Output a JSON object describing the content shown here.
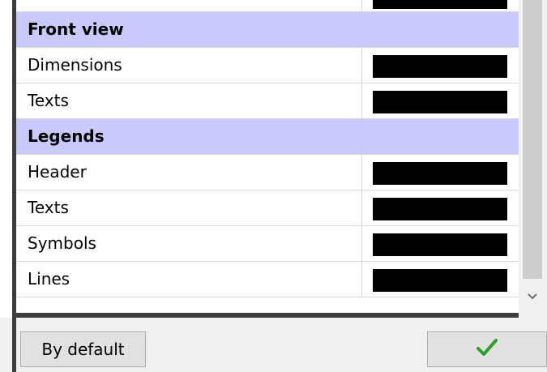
{
  "sections": [
    {
      "title": "Front view",
      "items": [
        {
          "label": "Dimensions",
          "color": "#000000"
        },
        {
          "label": "Texts",
          "color": "#000000"
        }
      ]
    },
    {
      "title": "Legends",
      "items": [
        {
          "label": "Header",
          "color": "#000000"
        },
        {
          "label": "Texts",
          "color": "#000000"
        },
        {
          "label": "Symbols",
          "color": "#000000"
        },
        {
          "label": "Lines",
          "color": "#000000"
        }
      ]
    }
  ],
  "buttons": {
    "default_label": "By default",
    "ok_icon": "checkmark-icon"
  },
  "colors": {
    "section_header_bg": "#c9c9fb",
    "ok_check": "#2e9e2e"
  }
}
